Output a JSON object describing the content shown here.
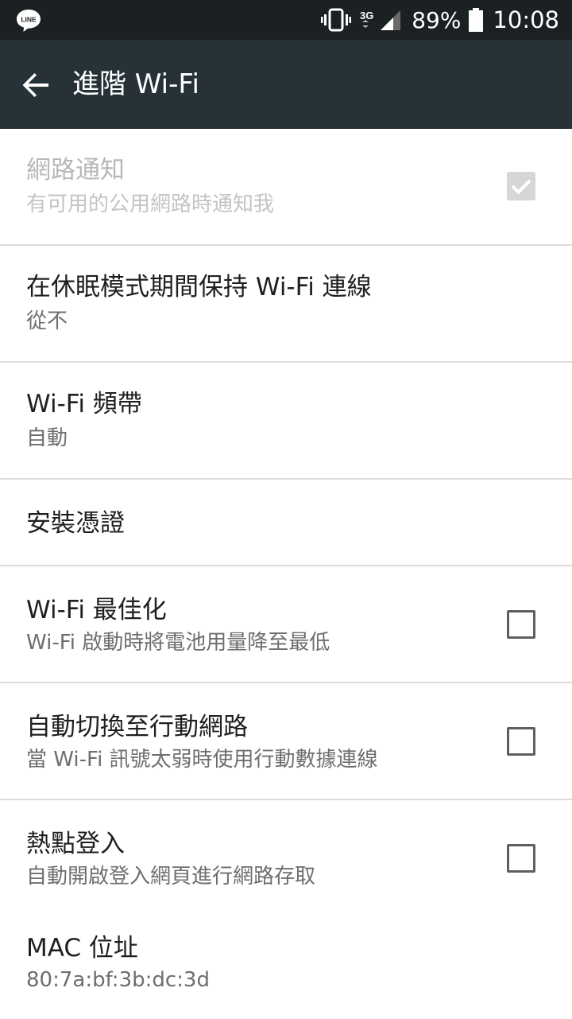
{
  "status_bar": {
    "app_icon": "line-icon",
    "app_icon_text": "LINE",
    "network": "3G",
    "battery_percent": "89%",
    "time": "10:08"
  },
  "app_bar": {
    "back_icon": "arrow-back-icon",
    "title": "進階 Wi-Fi"
  },
  "settings": [
    {
      "title": "網路通知",
      "subtitle": "有可用的公用網路時通知我",
      "control": "checkbox",
      "checked": true,
      "enabled": false
    },
    {
      "title": "在休眠模式期間保持 Wi-Fi 連線",
      "subtitle": "從不"
    },
    {
      "title": "Wi-Fi 頻帶",
      "subtitle": "自動"
    },
    {
      "title": "安裝憑證"
    },
    {
      "title": "Wi-Fi 最佳化",
      "subtitle": "Wi-Fi 啟動時將電池用量降至最低",
      "control": "checkbox",
      "checked": false,
      "enabled": true
    },
    {
      "title": "自動切換至行動網路",
      "subtitle": "當 Wi-Fi 訊號太弱時使用行動數據連線",
      "control": "checkbox",
      "checked": false,
      "enabled": true
    },
    {
      "title": "熱點登入",
      "subtitle": "自動開啟登入網頁進行網路存取",
      "control": "checkbox",
      "checked": false,
      "enabled": true
    },
    {
      "title": "MAC 位址",
      "subtitle": "80:7a:bf:3b:dc:3d"
    }
  ],
  "colors": {
    "status_bar": "#1b2023",
    "app_bar": "#263238",
    "divider": "#dcdcdc"
  }
}
